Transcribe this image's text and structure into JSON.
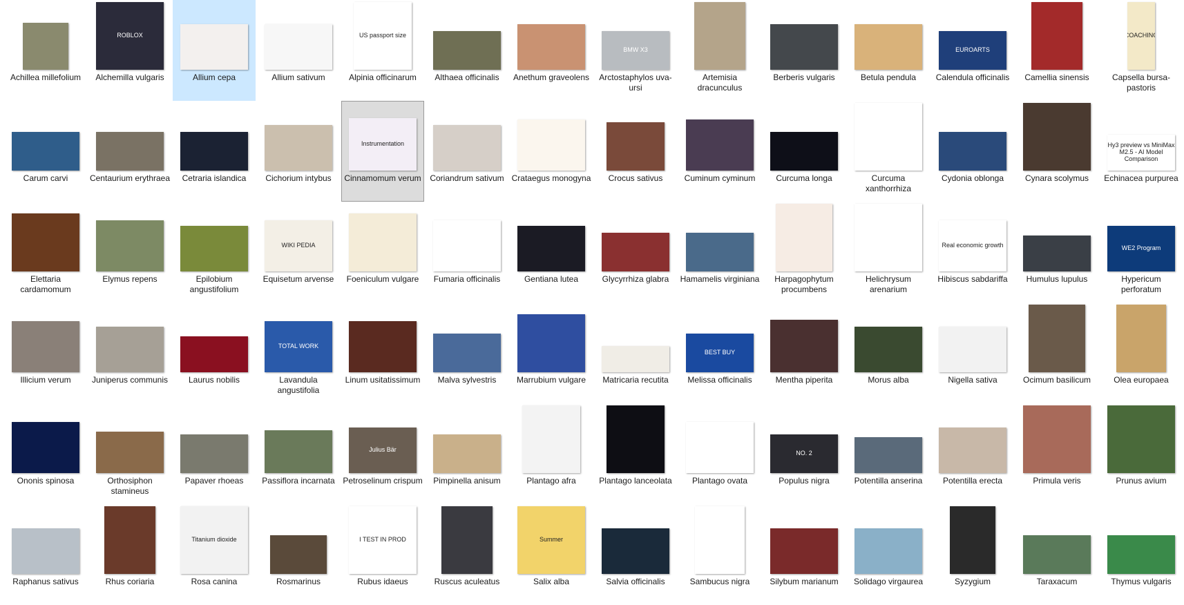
{
  "explorer": {
    "files": [
      {
        "name": "Achillea millefolium",
        "thumb": {
          "w": 66,
          "h": 68,
          "bg": "#8a8a6e",
          "icon": "grass-field-image-icon"
        }
      },
      {
        "name": "Alchemilla vulgaris",
        "thumb": {
          "w": 98,
          "h": 98,
          "bg": "#2b2b3a",
          "text": "ROBLOX",
          "icon": "roblox-image-icon"
        }
      },
      {
        "name": "Allium cepa",
        "thumb": {
          "w": 98,
          "h": 66,
          "bg": "#f3f0ee",
          "icon": "anatomy-diagram-image-icon"
        },
        "state": "selected"
      },
      {
        "name": "Allium sativum",
        "thumb": {
          "w": 98,
          "h": 66,
          "bg": "#f7f7f7",
          "icon": "line-chart-image-icon"
        }
      },
      {
        "name": "Alpinia officinarum",
        "thumb": {
          "w": 84,
          "h": 98,
          "bg": "#ffffff",
          "text": "US passport size",
          "icon": "passport-photo-image-icon"
        }
      },
      {
        "name": "Althaea officinalis",
        "thumb": {
          "w": 98,
          "h": 56,
          "bg": "#6f6f54",
          "icon": "car-image-icon"
        }
      },
      {
        "name": "Anethum graveolens",
        "thumb": {
          "w": 98,
          "h": 66,
          "bg": "#c99272",
          "icon": "desert-truck-image-icon"
        }
      },
      {
        "name": "Arctostaphylos uva-ursi",
        "thumb": {
          "w": 98,
          "h": 56,
          "bg": "#b8bcc0",
          "text": "BMW X3",
          "icon": "car-image-icon"
        }
      },
      {
        "name": "Artemisia dracunculus",
        "thumb": {
          "w": 74,
          "h": 98,
          "bg": "#b4a48a",
          "icon": "jar-image-icon"
        }
      },
      {
        "name": "Berberis vulgaris",
        "thumb": {
          "w": 98,
          "h": 66,
          "bg": "#44484c",
          "icon": "race-car-image-icon"
        }
      },
      {
        "name": "Betula pendula",
        "thumb": {
          "w": 98,
          "h": 66,
          "bg": "#d9b27a",
          "icon": "cake-image-icon"
        }
      },
      {
        "name": "Calendula officinalis",
        "thumb": {
          "w": 98,
          "h": 56,
          "bg": "#1f3f7a",
          "text": "EUROARTS",
          "icon": "portrait-image-icon"
        }
      },
      {
        "name": "Camellia sinensis",
        "thumb": {
          "w": 74,
          "h": 98,
          "bg": "#a32a2a",
          "icon": "illustration-image-icon"
        }
      },
      {
        "name": "Capsella bursa-pastoris",
        "thumb": {
          "w": 40,
          "h": 98,
          "bg": "#f3e9c8",
          "text": "COACHING",
          "icon": "infographic-image-icon"
        }
      },
      {
        "name": "Carum carvi",
        "thumb": {
          "w": 98,
          "h": 56,
          "bg": "#2f5d8a",
          "icon": "solar-panels-image-icon"
        }
      },
      {
        "name": "Centaurium erythraea",
        "thumb": {
          "w": 98,
          "h": 56,
          "bg": "#7a7264",
          "icon": "photo-image-icon"
        }
      },
      {
        "name": "Cetraria islandica",
        "thumb": {
          "w": 98,
          "h": 56,
          "bg": "#1b2233",
          "icon": "portrait-image-icon"
        }
      },
      {
        "name": "Cichorium intybus",
        "thumb": {
          "w": 98,
          "h": 66,
          "bg": "#cbbfae",
          "icon": "photo-image-icon"
        }
      },
      {
        "name": "Cinnamomum verum",
        "thumb": {
          "w": 98,
          "h": 76,
          "bg": "#f3eef6",
          "text": "Instrumentation",
          "icon": "slide-image-icon"
        },
        "state": "focused"
      },
      {
        "name": "Coriandrum sativum",
        "thumb": {
          "w": 98,
          "h": 66,
          "bg": "#d6cfc8",
          "icon": "flags-image-icon"
        }
      },
      {
        "name": "Crataegus monogyna",
        "thumb": {
          "w": 98,
          "h": 74,
          "bg": "#fbf6ee",
          "icon": "calendar-image-icon"
        }
      },
      {
        "name": "Crocus sativus",
        "thumb": {
          "w": 84,
          "h": 70,
          "bg": "#7a4a3a",
          "icon": "store-image-icon"
        }
      },
      {
        "name": "Cuminum cyminum",
        "thumb": {
          "w": 98,
          "h": 74,
          "bg": "#4a3c52",
          "icon": "hall-image-icon"
        }
      },
      {
        "name": "Curcuma longa",
        "thumb": {
          "w": 98,
          "h": 56,
          "bg": "#0e0f18",
          "icon": "space-image-icon"
        }
      },
      {
        "name": "Curcuma xanthorrhiza",
        "thumb": {
          "w": 98,
          "h": 98,
          "bg": "#ffffff",
          "icon": "bottle-image-icon"
        }
      },
      {
        "name": "Cydonia oblonga",
        "thumb": {
          "w": 98,
          "h": 56,
          "bg": "#2a4a7a",
          "icon": "chip-image-icon"
        }
      },
      {
        "name": "Cynara scolymus",
        "thumb": {
          "w": 98,
          "h": 98,
          "bg": "#4a3a30",
          "icon": "living-room-image-icon"
        }
      },
      {
        "name": "Echinacea purpurea",
        "thumb": {
          "w": 98,
          "h": 52,
          "bg": "#ffffff",
          "text": "Hy3 preview vs MiniMax M2.5 - AI Model Comparison",
          "icon": "text-card-image-icon"
        }
      },
      {
        "name": "Elettaria cardamomum",
        "thumb": {
          "w": 98,
          "h": 84,
          "bg": "#6a3a1e",
          "icon": "photo-image-icon"
        }
      },
      {
        "name": "Elymus repens",
        "thumb": {
          "w": 98,
          "h": 74,
          "bg": "#7d8a64",
          "icon": "field-image-icon"
        }
      },
      {
        "name": "Epilobium angustifolium",
        "thumb": {
          "w": 98,
          "h": 66,
          "bg": "#7a8a3a",
          "icon": "flowers-image-icon"
        }
      },
      {
        "name": "Equisetum arvense",
        "thumb": {
          "w": 98,
          "h": 74,
          "bg": "#f3efe6",
          "text": "WIKI PEDIA",
          "icon": "wikipedia-image-icon"
        }
      },
      {
        "name": "Foeniculum vulgare",
        "thumb": {
          "w": 98,
          "h": 84,
          "bg": "#f4ecd8",
          "icon": "diagram-image-icon"
        }
      },
      {
        "name": "Fumaria officinalis",
        "thumb": {
          "w": 98,
          "h": 74,
          "bg": "#ffffff",
          "icon": "line-chart-image-icon"
        }
      },
      {
        "name": "Gentiana lutea",
        "thumb": {
          "w": 98,
          "h": 66,
          "bg": "#1b1b24",
          "icon": "portrait-image-icon"
        }
      },
      {
        "name": "Glycyrrhiza glabra",
        "thumb": {
          "w": 98,
          "h": 56,
          "bg": "#8a3030",
          "icon": "photo-image-icon"
        }
      },
      {
        "name": "Hamamelis virginiana",
        "thumb": {
          "w": 98,
          "h": 56,
          "bg": "#4a6a8a",
          "icon": "photo-image-icon"
        }
      },
      {
        "name": "Harpagophytum procumbens",
        "thumb": {
          "w": 82,
          "h": 98,
          "bg": "#f6ece4",
          "icon": "floral-card-image-icon"
        }
      },
      {
        "name": "Helichrysum arenarium",
        "thumb": {
          "w": 98,
          "h": 98,
          "bg": "#ffffff",
          "icon": "discord-logo-image-icon"
        }
      },
      {
        "name": "Hibiscus sabdariffa",
        "thumb": {
          "w": 98,
          "h": 74,
          "bg": "#ffffff",
          "text": "Real economic growth",
          "icon": "bar-chart-image-icon"
        }
      },
      {
        "name": "Humulus lupulus",
        "thumb": {
          "w": 98,
          "h": 52,
          "bg": "#3a3f46",
          "icon": "motorcycle-image-icon"
        }
      },
      {
        "name": "Hypericum perforatum",
        "thumb": {
          "w": 98,
          "h": 66,
          "bg": "#0d3b7a",
          "text": "WE2 Program",
          "icon": "banner-image-icon"
        }
      },
      {
        "name": "Illicium verum",
        "thumb": {
          "w": 98,
          "h": 74,
          "bg": "#8a8078",
          "icon": "machine-image-icon"
        }
      },
      {
        "name": "Juniperus communis",
        "thumb": {
          "w": 98,
          "h": 66,
          "bg": "#a6a096",
          "icon": "car-image-icon"
        }
      },
      {
        "name": "Laurus nobilis",
        "thumb": {
          "w": 98,
          "h": 52,
          "bg": "#8a1020",
          "icon": "table-image-icon"
        }
      },
      {
        "name": "Lavandula angustifolia",
        "thumb": {
          "w": 98,
          "h": 74,
          "bg": "#2a5aaa",
          "text": "TOTAL WORK",
          "icon": "game-screen-image-icon"
        }
      },
      {
        "name": "Linum usitatissimum",
        "thumb": {
          "w": 98,
          "h": 74,
          "bg": "#5a2a20",
          "icon": "portrait-image-icon"
        }
      },
      {
        "name": "Malva sylvestris",
        "thumb": {
          "w": 98,
          "h": 56,
          "bg": "#4a6a9a",
          "icon": "sky-image-icon"
        }
      },
      {
        "name": "Marrubium vulgare",
        "thumb": {
          "w": 98,
          "h": 84,
          "bg": "#2f4ea0",
          "icon": "photo-image-icon"
        }
      },
      {
        "name": "Matricaria recutita",
        "thumb": {
          "w": 98,
          "h": 38,
          "bg": "#f0ede6",
          "icon": "photo-image-icon"
        }
      },
      {
        "name": "Melissa officinalis",
        "thumb": {
          "w": 98,
          "h": 56,
          "bg": "#1a4aa0",
          "text": "BEST BUY",
          "icon": "ad-banner-image-icon"
        }
      },
      {
        "name": "Mentha piperita",
        "thumb": {
          "w": 98,
          "h": 76,
          "bg": "#4a3030",
          "icon": "wallet-image-icon"
        }
      },
      {
        "name": "Morus alba",
        "thumb": {
          "w": 98,
          "h": 66,
          "bg": "#3a4a30",
          "icon": "crowd-image-icon"
        }
      },
      {
        "name": "Nigella sativa",
        "thumb": {
          "w": 98,
          "h": 66,
          "bg": "#f2f2f2",
          "icon": "watch-image-icon"
        }
      },
      {
        "name": "Ocimum basilicum",
        "thumb": {
          "w": 82,
          "h": 98,
          "bg": "#6a5a4a",
          "icon": "portrait-image-icon"
        }
      },
      {
        "name": "Olea europaea",
        "thumb": {
          "w": 72,
          "h": 98,
          "bg": "#c9a46a",
          "icon": "wood-texture-image-icon"
        }
      },
      {
        "name": "Ononis spinosa",
        "thumb": {
          "w": 98,
          "h": 74,
          "bg": "#0b1a4a",
          "icon": "event-poster-image-icon"
        }
      },
      {
        "name": "Orthosiphon stamineus",
        "thumb": {
          "w": 98,
          "h": 60,
          "bg": "#8a6a4a",
          "icon": "collage-image-icon"
        }
      },
      {
        "name": "Papaver rhoeas",
        "thumb": {
          "w": 98,
          "h": 56,
          "bg": "#7a7a6e",
          "icon": "photo-image-icon"
        }
      },
      {
        "name": "Passiflora incarnata",
        "thumb": {
          "w": 98,
          "h": 62,
          "bg": "#6a7a5a",
          "icon": "landscape-image-icon"
        }
      },
      {
        "name": "Petroselinum crispum",
        "thumb": {
          "w": 98,
          "h": 66,
          "bg": "#6a5e52",
          "text": "Julius Bär",
          "icon": "building-image-icon"
        }
      },
      {
        "name": "Pimpinella anisum",
        "thumb": {
          "w": 98,
          "h": 56,
          "bg": "#c9b08a",
          "icon": "map-image-icon"
        }
      },
      {
        "name": "Plantago afra",
        "thumb": {
          "w": 84,
          "h": 98,
          "bg": "#f3f3f3",
          "icon": "menu-board-image-icon"
        }
      },
      {
        "name": "Plantago lanceolata",
        "thumb": {
          "w": 84,
          "h": 98,
          "bg": "#0e0e14",
          "icon": "social-post-image-icon"
        }
      },
      {
        "name": "Plantago ovata",
        "thumb": {
          "w": 98,
          "h": 74,
          "bg": "#ffffff",
          "icon": "tower-drawing-image-icon"
        }
      },
      {
        "name": "Populus nigra",
        "thumb": {
          "w": 98,
          "h": 56,
          "bg": "#2a2a30",
          "text": "NO. 2",
          "icon": "video-thumbnail-image-icon"
        }
      },
      {
        "name": "Potentilla anserina",
        "thumb": {
          "w": 98,
          "h": 52,
          "bg": "#5a6a7a",
          "icon": "photo-image-icon"
        }
      },
      {
        "name": "Potentilla erecta",
        "thumb": {
          "w": 98,
          "h": 66,
          "bg": "#c8b8a8",
          "icon": "photo-image-icon"
        }
      },
      {
        "name": "Primula veris",
        "thumb": {
          "w": 98,
          "h": 98,
          "bg": "#a86a5a",
          "icon": "portrait-image-icon"
        }
      },
      {
        "name": "Prunus avium",
        "thumb": {
          "w": 98,
          "h": 98,
          "bg": "#4a6a3a",
          "icon": "plant-image-icon"
        }
      },
      {
        "name": "Raphanus sativus",
        "thumb": {
          "w": 98,
          "h": 66,
          "bg": "#b8c0c8",
          "icon": "group-photo-image-icon"
        }
      },
      {
        "name": "Rhus coriaria",
        "thumb": {
          "w": 74,
          "h": 98,
          "bg": "#6a3a2a",
          "icon": "plant-image-icon"
        }
      },
      {
        "name": "Rosa canina",
        "thumb": {
          "w": 98,
          "h": 98,
          "bg": "#f2f2f2",
          "text": "Titanium dioxide",
          "icon": "powder-image-icon"
        }
      },
      {
        "name": "Rosmarinus",
        "thumb": {
          "w": 82,
          "h": 56,
          "bg": "#5a4a3a",
          "icon": "photo-image-icon"
        }
      },
      {
        "name": "Rubus idaeus",
        "thumb": {
          "w": 98,
          "h": 98,
          "bg": "#ffffff",
          "text": "I TEST IN PROD",
          "icon": "tshirt-image-icon"
        }
      },
      {
        "name": "Ruscus aculeatus",
        "thumb": {
          "w": 74,
          "h": 98,
          "bg": "#3a3a40",
          "icon": "device-image-icon"
        }
      },
      {
        "name": "Salix alba",
        "thumb": {
          "w": 98,
          "h": 98,
          "bg": "#f2d36a",
          "text": "Summer",
          "icon": "stickers-image-icon"
        }
      },
      {
        "name": "Salvia officinalis",
        "thumb": {
          "w": 98,
          "h": 66,
          "bg": "#1a2a3a",
          "icon": "phone-case-image-icon"
        }
      },
      {
        "name": "Sambucus nigra",
        "thumb": {
          "w": 72,
          "h": 98,
          "bg": "#ffffff",
          "icon": "sheet-music-image-icon"
        }
      },
      {
        "name": "Silybum marianum",
        "thumb": {
          "w": 98,
          "h": 66,
          "bg": "#7a2a2a",
          "icon": "portrait-image-icon"
        }
      },
      {
        "name": "Solidago virgaurea",
        "thumb": {
          "w": 98,
          "h": 66,
          "bg": "#8ab0c8",
          "icon": "wind-turbines-image-icon"
        }
      },
      {
        "name": "Syzygium",
        "thumb": {
          "w": 66,
          "h": 98,
          "bg": "#2a2a2a",
          "icon": "game-cover-image-icon"
        }
      },
      {
        "name": "Taraxacum",
        "thumb": {
          "w": 98,
          "h": 56,
          "bg": "#5a7a5a",
          "icon": "photo-image-icon"
        }
      },
      {
        "name": "Thymus vulgaris",
        "thumb": {
          "w": 98,
          "h": 56,
          "bg": "#3a8a4a",
          "icon": "cartoon-image-icon"
        }
      }
    ]
  }
}
